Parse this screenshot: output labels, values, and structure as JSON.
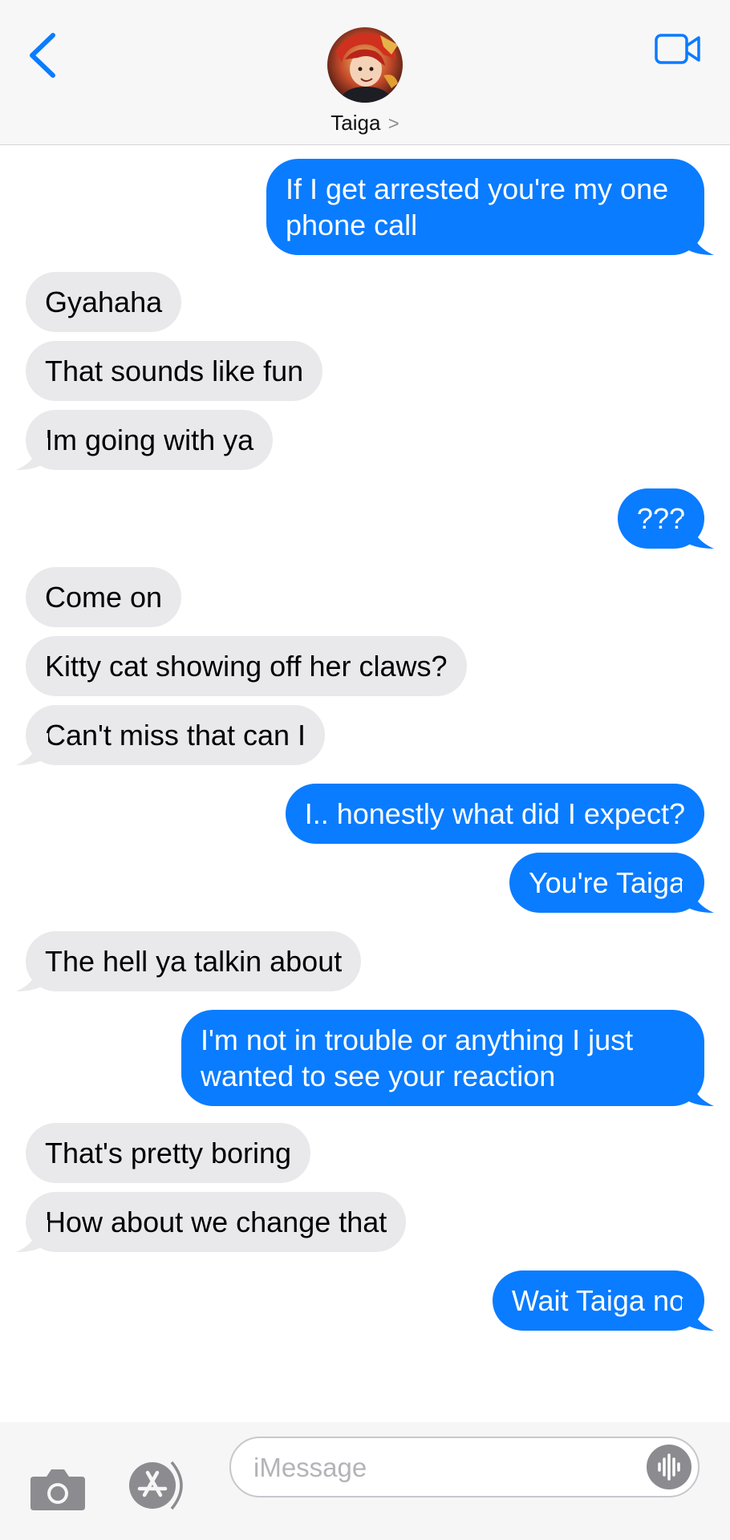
{
  "header": {
    "contact_name": "Taiga",
    "chevron": ">",
    "icons": {
      "back": "chevron-left-icon",
      "video": "video-camera-icon"
    }
  },
  "messages": [
    {
      "side": "out",
      "text": "If I get arrested you're my one phone call"
    },
    {
      "side": "in",
      "text": "Gyahaha"
    },
    {
      "side": "in",
      "text": "That sounds like fun"
    },
    {
      "side": "in",
      "text": "Im going with ya"
    },
    {
      "side": "out",
      "text": "???"
    },
    {
      "side": "in",
      "text": "Come on"
    },
    {
      "side": "in",
      "text": "Kitty cat showing off her claws?"
    },
    {
      "side": "in",
      "text": "Can't miss that can I"
    },
    {
      "side": "out",
      "text": "I.. honestly what did I expect?"
    },
    {
      "side": "out",
      "text": "You're Taiga"
    },
    {
      "side": "in",
      "text": "The hell ya talkin about"
    },
    {
      "side": "out",
      "text": "I'm not in trouble or anything I just wanted to see your reaction"
    },
    {
      "side": "in",
      "text": "That's pretty boring"
    },
    {
      "side": "in",
      "text": "How about we change that"
    },
    {
      "side": "out",
      "text": "Wait Taiga no"
    }
  ],
  "input": {
    "placeholder": "iMessage",
    "value": "",
    "icons": {
      "camera": "camera-icon",
      "apps": "app-store-icon",
      "audio": "audio-waveform-icon"
    }
  },
  "colors": {
    "outgoing_bubble": "#0a7cff",
    "incoming_bubble": "#e9e9eb",
    "accent": "#0a7cff"
  }
}
